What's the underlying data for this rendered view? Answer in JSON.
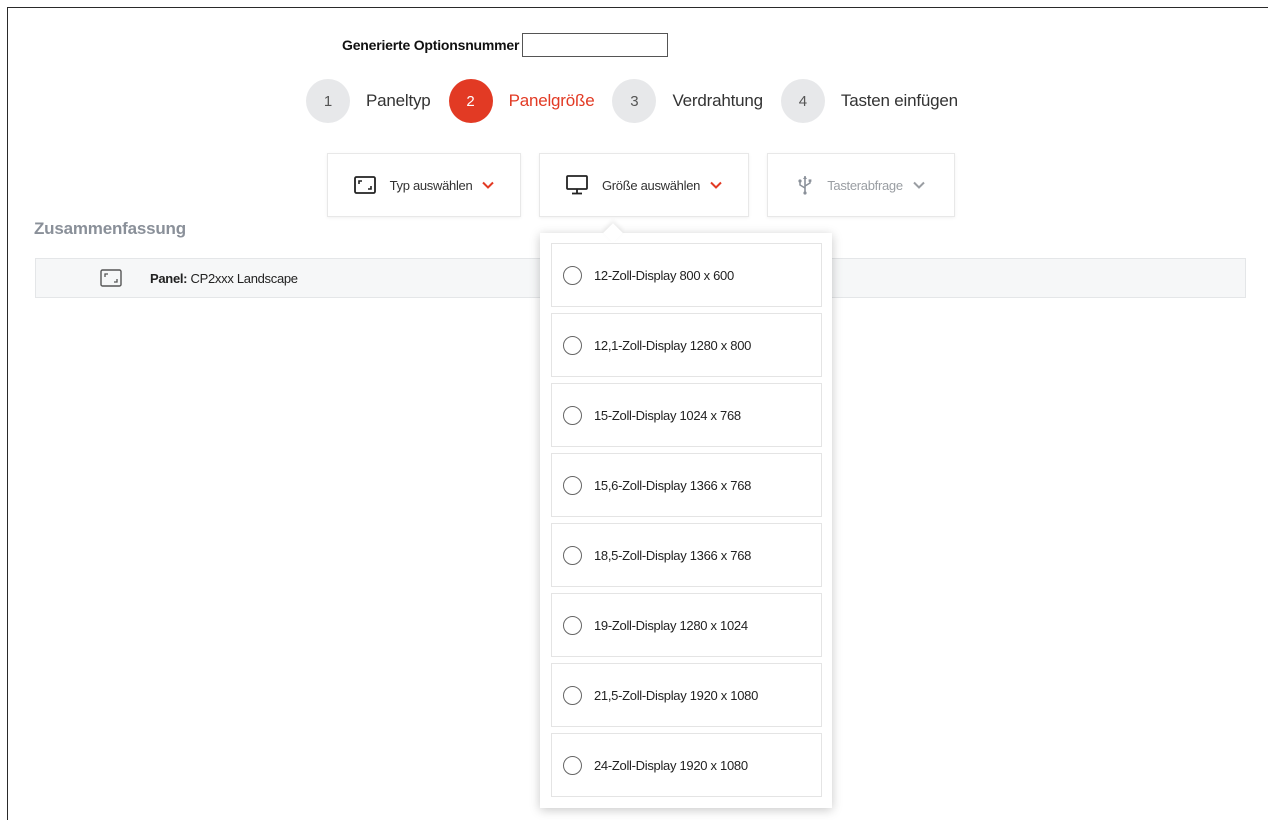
{
  "header": {
    "option_label": "Generierte Optionsnummer",
    "option_value": ""
  },
  "steps": [
    {
      "num": "1",
      "label": "Paneltyp",
      "active": false
    },
    {
      "num": "2",
      "label": "Panelgröße",
      "active": true
    },
    {
      "num": "3",
      "label": "Verdrahtung",
      "active": false
    },
    {
      "num": "4",
      "label": "Tasten einfügen",
      "active": false
    }
  ],
  "dropdowns": {
    "type": {
      "label": "Typ auswählen",
      "icon": "panel-frame-icon"
    },
    "size": {
      "label": "Größe auswählen",
      "icon": "monitor-icon"
    },
    "keys": {
      "label": "Tasterabfrage",
      "icon": "usb-icon"
    }
  },
  "summary": {
    "title": "Zusammenfassung",
    "panel_key": "Panel:",
    "panel_value": "CP2xxx Landscape"
  },
  "size_options": [
    "12-Zoll-Display 800 x 600",
    "12,1-Zoll-Display 1280 x 800",
    "15-Zoll-Display 1024 x 768",
    "15,6-Zoll-Display 1366 x 768",
    "18,5-Zoll-Display 1366 x 768",
    "19-Zoll-Display 1280 x 1024",
    "21,5-Zoll-Display 1920 x 1080",
    "24-Zoll-Display 1920 x 1080"
  ],
  "colors": {
    "accent": "#e23a24",
    "muted": "#8a9099"
  }
}
